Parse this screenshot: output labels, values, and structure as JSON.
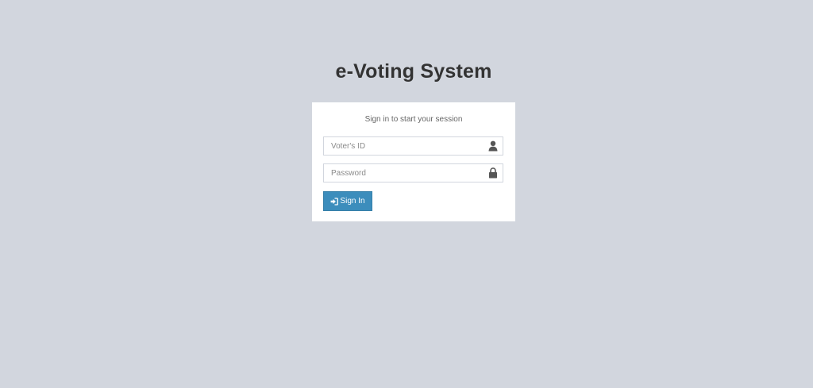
{
  "header": {
    "title": "e-Voting System"
  },
  "login": {
    "message": "Sign in to start your session",
    "voter_id": {
      "placeholder": "Voter's ID",
      "value": "",
      "icon": "user-icon"
    },
    "password": {
      "placeholder": "Password",
      "value": "",
      "icon": "lock-icon"
    },
    "submit": {
      "label": "Sign In",
      "icon": "sign-in-icon",
      "color": "#3c8dbc"
    }
  },
  "colors": {
    "background": "#d2d6de",
    "box": "#ffffff",
    "title": "#333333"
  }
}
